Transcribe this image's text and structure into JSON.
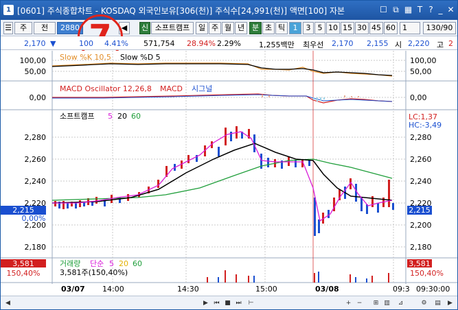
{
  "titlebar": {
    "app_number": "1",
    "title": "[0601] 주식종합차트 - KOSDAQ 외국인보유[306(천)] 주식수[24,991(천)] 액면[100] 자본"
  },
  "toolbar": {
    "market": "주",
    "period_label": "전",
    "code": "2880",
    "stamp_number": "7",
    "stock_tag": "신",
    "stock_name": "소프트캠프",
    "period_buttons": [
      "일",
      "주",
      "월",
      "년",
      "분",
      "초",
      "틱"
    ],
    "interval_buttons": [
      "1",
      "3",
      "5",
      "10",
      "15",
      "30",
      "45",
      "60"
    ],
    "interval_select": "1",
    "count_display": "130/90"
  },
  "quote": {
    "price": "2,170",
    "change_arrow": "▼",
    "change": "100",
    "change_pct": "4.41%",
    "volume": "571,754",
    "turnover_pct": "28.94%",
    "ratio": "2.29%",
    "amount": "1,255백만",
    "priority_label": "최우선",
    "ask": "2,170",
    "bid": "2,155",
    "open_label": "시",
    "open": "2,220",
    "high_label": "고",
    "high": "2"
  },
  "panes": {
    "stochastic": {
      "label_k": "Slow %K 10,5",
      "label_d": "Slow %D 5",
      "axis": [
        "100,00",
        "50,00"
      ]
    },
    "macd": {
      "label_osc": "MACD Oscillator 12,26,8",
      "label_macd": "MACD",
      "label_signal": "시그널",
      "axis": [
        "0,00"
      ]
    },
    "price": {
      "name": "소프트캠프",
      "ma": [
        "5",
        "20",
        "60"
      ],
      "axis": [
        "2,280",
        "2,260",
        "2,240",
        "2,220",
        "2,200",
        "2,180"
      ],
      "current": "2,215",
      "left_current": "2,215",
      "left_pct": "0,00%",
      "lc": "LC:1,37",
      "hc": "HC:-3,49"
    },
    "volume": {
      "label": "거래량",
      "type": "단순",
      "ma": [
        "5",
        "20",
        "60"
      ],
      "detail": "3,581주(150,40%)",
      "left_value": "3,581",
      "left_pct": "150,40%",
      "right_value": "3,581",
      "right_pct": "150,40%"
    }
  },
  "xaxis": {
    "labels": [
      "03/07",
      "14:00",
      "14:30",
      "15:00",
      "03/08",
      "09:3"
    ],
    "time_display": "09:30:00"
  },
  "colors": {
    "up": "#d21f1f",
    "down": "#1a4fd0",
    "ma5": "#d81bd8",
    "ma20": "#000000",
    "ma60": "#1f9e3a",
    "stoch_k": "#e38f2a",
    "macd": "#d21f1f",
    "signal": "#1a4fd0"
  }
}
